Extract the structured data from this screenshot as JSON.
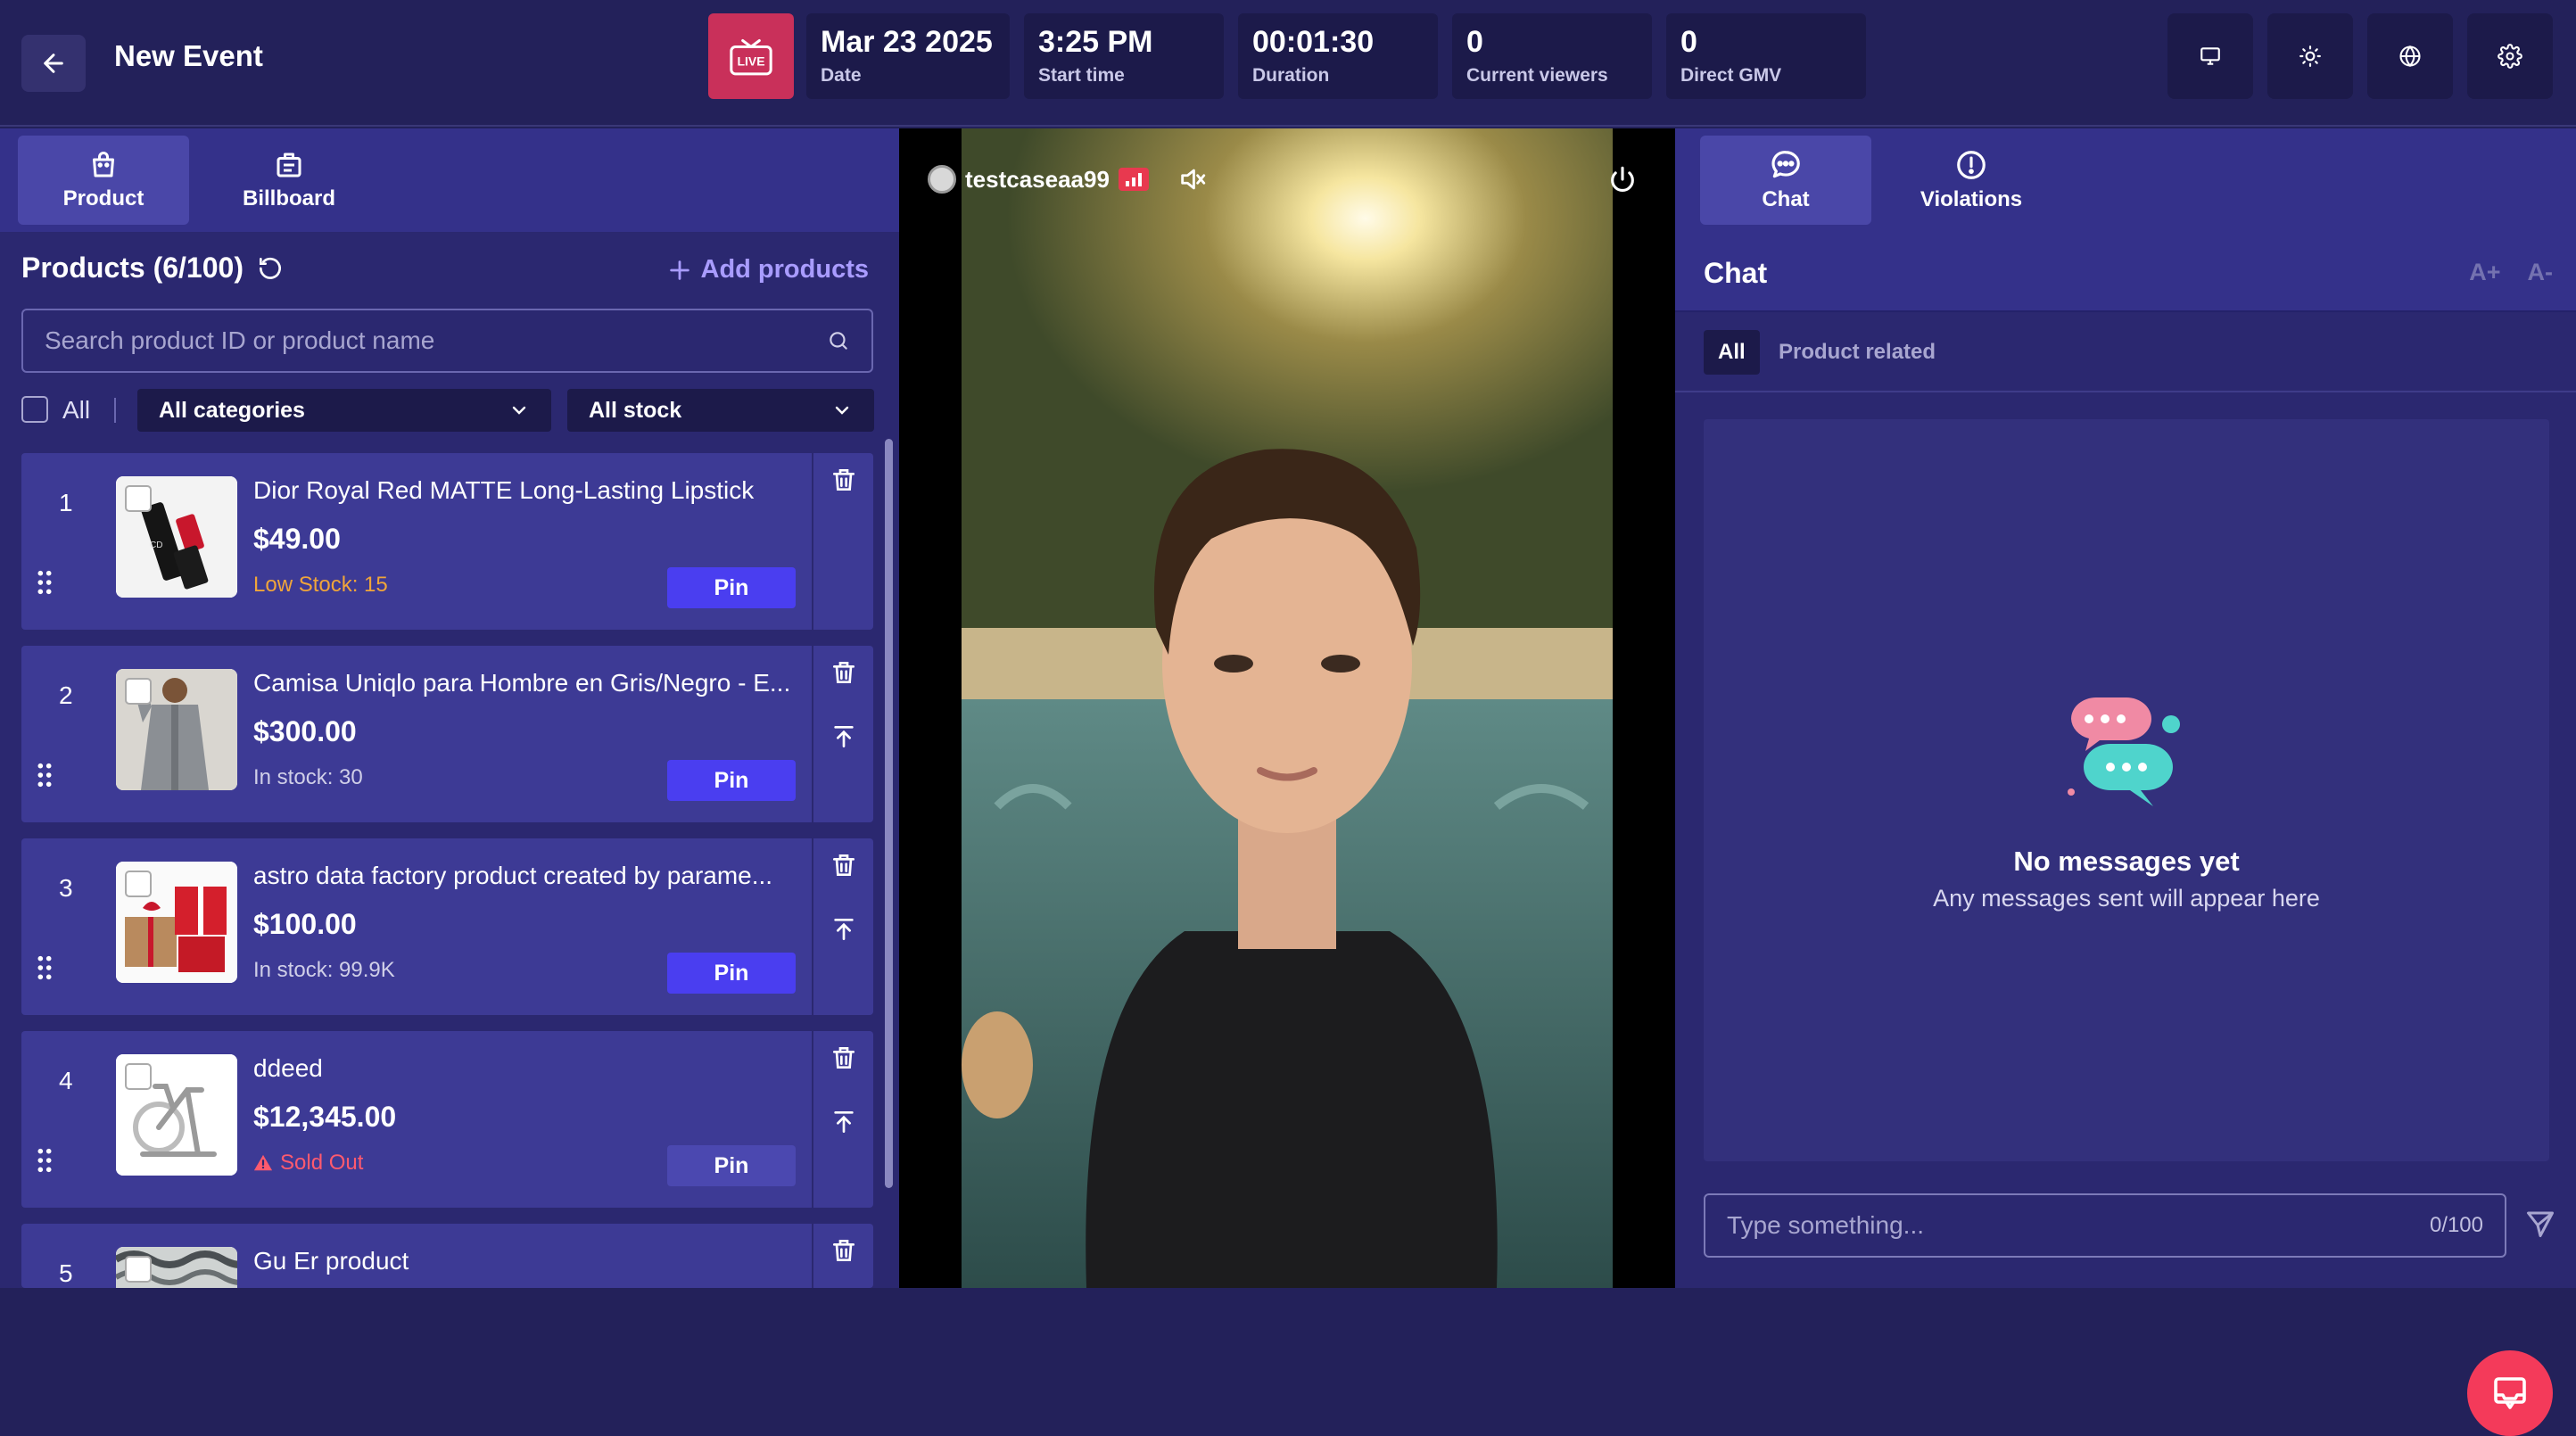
{
  "header": {
    "title": "New Event",
    "live_label": "LIVE",
    "stats": [
      {
        "value": "Mar 23 2025",
        "label": "Date"
      },
      {
        "value": "3:25 PM",
        "label": "Start time"
      },
      {
        "value": "00:01:30",
        "label": "Duration"
      },
      {
        "value": "0",
        "label": "Current viewers"
      },
      {
        "value": "0",
        "label": "Direct GMV"
      }
    ],
    "tools": [
      "monitor-icon",
      "brightness-icon",
      "globe-icon",
      "gear-icon"
    ]
  },
  "left": {
    "tabs": [
      {
        "label": "Product",
        "icon": "shopping-bag-icon",
        "active": true
      },
      {
        "label": "Billboard",
        "icon": "billboard-icon",
        "active": false
      }
    ],
    "products_title": "Products (6/100)",
    "add_products": "Add products",
    "search_placeholder": "Search product ID or product name",
    "select_all_label": "All",
    "category_filter": "All categories",
    "stock_filter": "All stock",
    "pin_label": "Pin",
    "products": [
      {
        "index": "1",
        "name": "Dior Royal Red MATTE Long-Lasting Lipstick",
        "price": "$49.00",
        "stock": "Low Stock: 15",
        "stock_status": "low",
        "image": "lipstick"
      },
      {
        "index": "2",
        "name": "Camisa Uniqlo para Hombre en Gris/Negro - E...",
        "price": "$300.00",
        "stock": "In stock: 30",
        "stock_status": "normal",
        "image": "shirt"
      },
      {
        "index": "3",
        "name": "astro data factory product created by parame...",
        "price": "$100.00",
        "stock": "In stock: 99.9K",
        "stock_status": "normal",
        "image": "gifts"
      },
      {
        "index": "4",
        "name": "ddeed",
        "price": "$12,345.00",
        "stock": "Sold Out",
        "stock_status": "out",
        "image": "bike"
      },
      {
        "index": "5",
        "name": "Gu Er product",
        "price": "",
        "stock": "",
        "stock_status": "normal",
        "image": "pattern"
      }
    ]
  },
  "video": {
    "username": "testcaseaa99"
  },
  "right": {
    "tabs": [
      {
        "label": "Chat",
        "icon": "chat-bubble-icon",
        "active": true
      },
      {
        "label": "Violations",
        "icon": "alert-circle-icon",
        "active": false
      }
    ],
    "chat_title": "Chat",
    "font_increase": "A+",
    "font_decrease": "A-",
    "filters": [
      {
        "label": "All",
        "active": true
      },
      {
        "label": "Product related",
        "active": false
      }
    ],
    "empty_title": "No messages yet",
    "empty_subtitle": "Any messages sent will appear here",
    "input_placeholder": "Type something...",
    "char_count": "0/100"
  }
}
